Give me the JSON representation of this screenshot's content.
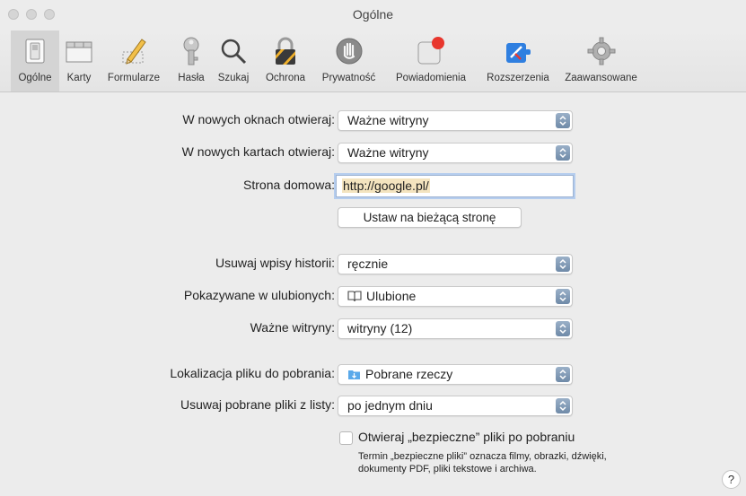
{
  "window": {
    "title": "Ogólne"
  },
  "toolbar": {
    "tabs": [
      {
        "label": "Ogólne",
        "icon": "switch-icon",
        "active": true
      },
      {
        "label": "Karty",
        "icon": "tabs-icon"
      },
      {
        "label": "Formularze",
        "icon": "pencil-icon"
      },
      {
        "label": "Hasła",
        "icon": "key-icon"
      },
      {
        "label": "Szukaj",
        "icon": "magnifier-icon"
      },
      {
        "label": "Ochrona",
        "icon": "lock-icon"
      },
      {
        "label": "Prywatność",
        "icon": "hand-icon"
      },
      {
        "label": "Powiadomienia",
        "icon": "notification-icon"
      },
      {
        "label": "Rozszerzenia",
        "icon": "puzzle-icon"
      },
      {
        "label": "Zaawansowane",
        "icon": "gear-icon"
      }
    ]
  },
  "form": {
    "new_windows_label": "W nowych oknach otwieraj:",
    "new_windows_value": "Ważne witryny",
    "new_tabs_label": "W nowych kartach otwieraj:",
    "new_tabs_value": "Ważne witryny",
    "homepage_label": "Strona domowa:",
    "homepage_value": "http://google.pl/",
    "set_current_label": "Ustaw na bieżącą stronę",
    "history_label": "Usuwaj wpisy historii:",
    "history_value": "ręcznie",
    "favorites_label": "Pokazywane w ulubionych:",
    "favorites_value": "Ulubione",
    "top_sites_label": "Ważne witryny:",
    "top_sites_value": "witryny (12)",
    "download_location_label": "Lokalizacja pliku do pobrania:",
    "download_location_value": "Pobrane rzeczy",
    "remove_downloads_label": "Usuwaj pobrane pliki z listy:",
    "remove_downloads_value": "po jednym dniu",
    "safe_files_label": "Otwieraj „bezpieczne” pliki po pobraniu",
    "safe_files_checked": false,
    "safe_files_note": "Termin „bezpieczne pliki” oznacza filmy, obrazki, dźwięki, dokumenty PDF, pliki tekstowe i archiwa."
  },
  "help": {
    "label": "?"
  },
  "colors": {
    "accent": "#2a73d9",
    "chevron": "#7f98b6",
    "background": "#ececec"
  }
}
